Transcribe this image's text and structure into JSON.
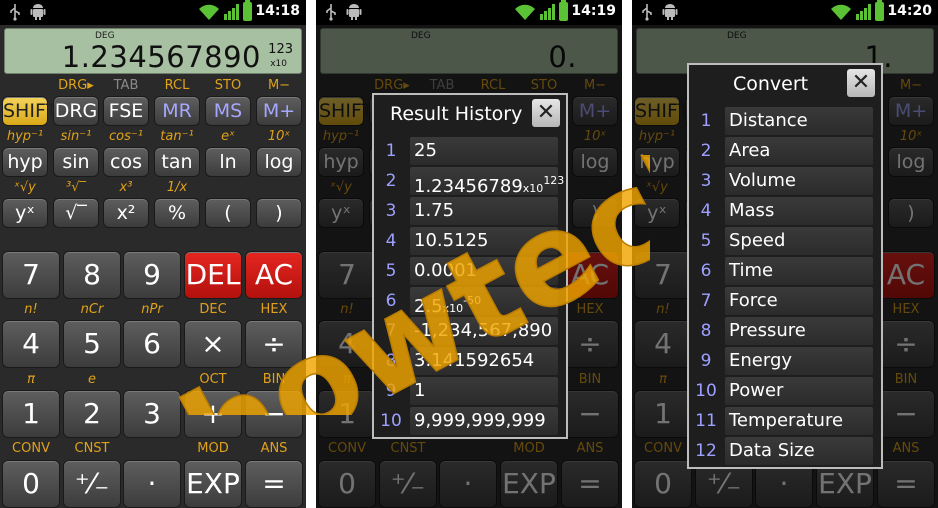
{
  "status_bar": {
    "times": [
      "14:18",
      "14:19",
      "14:20"
    ]
  },
  "display": {
    "mode": "DEG",
    "screen1": {
      "value": "1.234567890",
      "exponent": "123",
      "x10": "x10"
    },
    "screen2": {
      "value": "0."
    },
    "screen3": {
      "value": "1."
    }
  },
  "labels": {
    "row1": [
      "DRG▸",
      "TAB",
      "RCL",
      "STO",
      "M−"
    ],
    "row2": [
      "hyp⁻¹",
      "sin⁻¹",
      "cos⁻¹",
      "tan⁻¹",
      "eˣ",
      "10ˣ"
    ],
    "row3": [
      "ˣ√y",
      "³√‾",
      "x³",
      "1/x"
    ],
    "row4": [
      "n!",
      "nCr",
      "nPr",
      "DEC",
      "HEX"
    ],
    "row5": [
      "π",
      "e",
      "OCT",
      "BIN"
    ],
    "row6": [
      "CONV",
      "CNST",
      "MOD",
      "ANS"
    ]
  },
  "keys": {
    "row1": [
      "SHIFT",
      "DRG",
      "FSE",
      "MR",
      "MS",
      "M+"
    ],
    "row2": [
      "hyp",
      "sin",
      "cos",
      "tan",
      "ln",
      "log"
    ],
    "row3": [
      "yˣ",
      "√‾",
      "x²",
      "%",
      "(",
      ")"
    ],
    "row4": [
      "7",
      "8",
      "9",
      "DEL",
      "AC"
    ],
    "row5": [
      "4",
      "5",
      "6",
      "×",
      "÷"
    ],
    "row6": [
      "1",
      "2",
      "3",
      "+",
      "−"
    ],
    "row7": [
      "0",
      "⁺⁄₋",
      "·",
      "EXP",
      "="
    ]
  },
  "history_dialog": {
    "title": "Result History",
    "close": "✕",
    "items": [
      {
        "num": "1",
        "text": "25"
      },
      {
        "num": "2",
        "text": "1.23456789",
        "x10": "x10",
        "exp": "123"
      },
      {
        "num": "3",
        "text": "1.75"
      },
      {
        "num": "4",
        "text": "10.5125"
      },
      {
        "num": "5",
        "text": "0.0001"
      },
      {
        "num": "6",
        "text": "2.5",
        "x10": "x10",
        "exp": "-50"
      },
      {
        "num": "7",
        "text": "-1,234,567,890"
      },
      {
        "num": "8",
        "text": "3.141592654"
      },
      {
        "num": "9",
        "text": "1"
      },
      {
        "num": "10",
        "text": "9,999,999,999"
      }
    ]
  },
  "convert_dialog": {
    "title": "Convert",
    "close": "✕",
    "items": [
      {
        "num": "1",
        "text": "Distance"
      },
      {
        "num": "2",
        "text": "Area"
      },
      {
        "num": "3",
        "text": "Volume"
      },
      {
        "num": "4",
        "text": "Mass"
      },
      {
        "num": "5",
        "text": "Speed"
      },
      {
        "num": "6",
        "text": "Time"
      },
      {
        "num": "7",
        "text": "Force"
      },
      {
        "num": "8",
        "text": "Pressure"
      },
      {
        "num": "9",
        "text": "Energy"
      },
      {
        "num": "10",
        "text": "Power"
      },
      {
        "num": "11",
        "text": "Temperature"
      },
      {
        "num": "12",
        "text": "Data Size"
      }
    ]
  },
  "watermark": {
    "text": "howtech",
    "color": "#f0a500"
  }
}
